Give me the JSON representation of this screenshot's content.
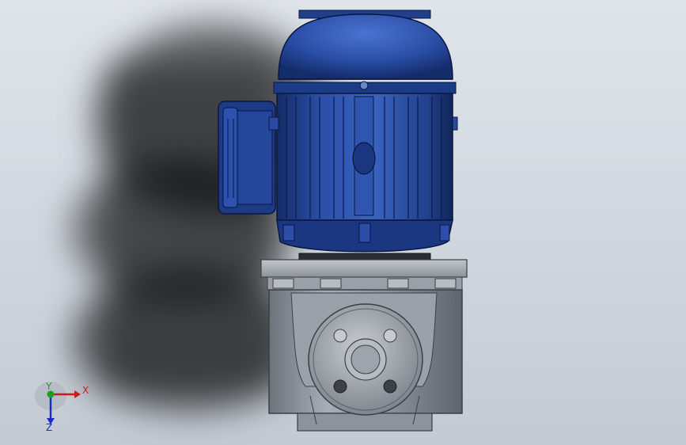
{
  "viewport": {
    "background_top": "#dfe4ea",
    "background_bottom": "#c3cad2"
  },
  "model": {
    "motor_color": "#1e3f8f",
    "gearbox_color": "#8a9098"
  },
  "triad": {
    "x_label": "X",
    "y_label": "Y",
    "z_label": "Z",
    "x_color": "#cc1a1a",
    "y_color": "#1aa01a",
    "z_color": "#1a2acc"
  }
}
